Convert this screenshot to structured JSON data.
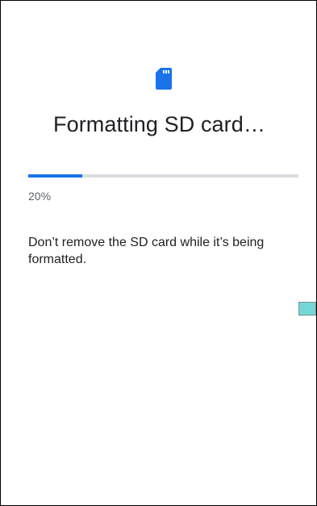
{
  "screen": {
    "icon": "sd-card-icon",
    "title": "Formatting SD card…",
    "progress": {
      "percent": 20,
      "label": "20%",
      "track_color": "#dadce0",
      "fill_color": "#1a73e8"
    },
    "message": "Don’t remove the SD card while it’s being formatted."
  },
  "colors": {
    "accent": "#1a73e8",
    "text_primary": "#202124",
    "text_secondary": "#5f6368",
    "edge_handle": "#74d8d8"
  }
}
